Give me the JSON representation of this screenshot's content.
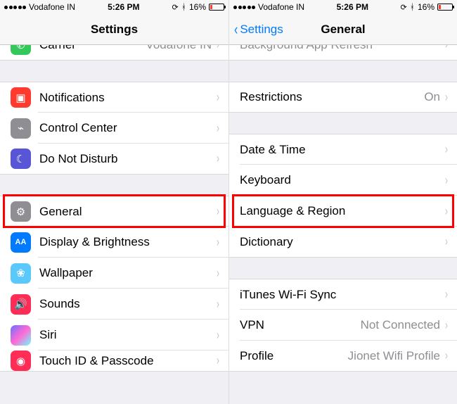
{
  "status": {
    "carrier": "Vodafone IN",
    "time": "5:26 PM",
    "battery_pct": "16%"
  },
  "left": {
    "title": "Settings",
    "rows": {
      "carrier": {
        "label": "Carrier",
        "value": "Vodafone IN"
      },
      "notifications": {
        "label": "Notifications"
      },
      "control_center": {
        "label": "Control Center"
      },
      "dnd": {
        "label": "Do Not Disturb"
      },
      "general": {
        "label": "General"
      },
      "display": {
        "label": "Display & Brightness"
      },
      "wallpaper": {
        "label": "Wallpaper"
      },
      "sounds": {
        "label": "Sounds"
      },
      "siri": {
        "label": "Siri"
      },
      "touchid": {
        "label": "Touch ID & Passcode"
      }
    }
  },
  "right": {
    "back": "Settings",
    "title": "General",
    "rows": {
      "bg_refresh": {
        "label": "Background App Refresh"
      },
      "restrictions": {
        "label": "Restrictions",
        "value": "On"
      },
      "date_time": {
        "label": "Date & Time"
      },
      "keyboard": {
        "label": "Keyboard"
      },
      "lang_region": {
        "label": "Language & Region"
      },
      "dictionary": {
        "label": "Dictionary"
      },
      "itunes_wifi": {
        "label": "iTunes Wi-Fi Sync"
      },
      "vpn": {
        "label": "VPN",
        "value": "Not Connected"
      },
      "profile": {
        "label": "Profile",
        "value": "Jionet Wifi Profile"
      }
    }
  }
}
